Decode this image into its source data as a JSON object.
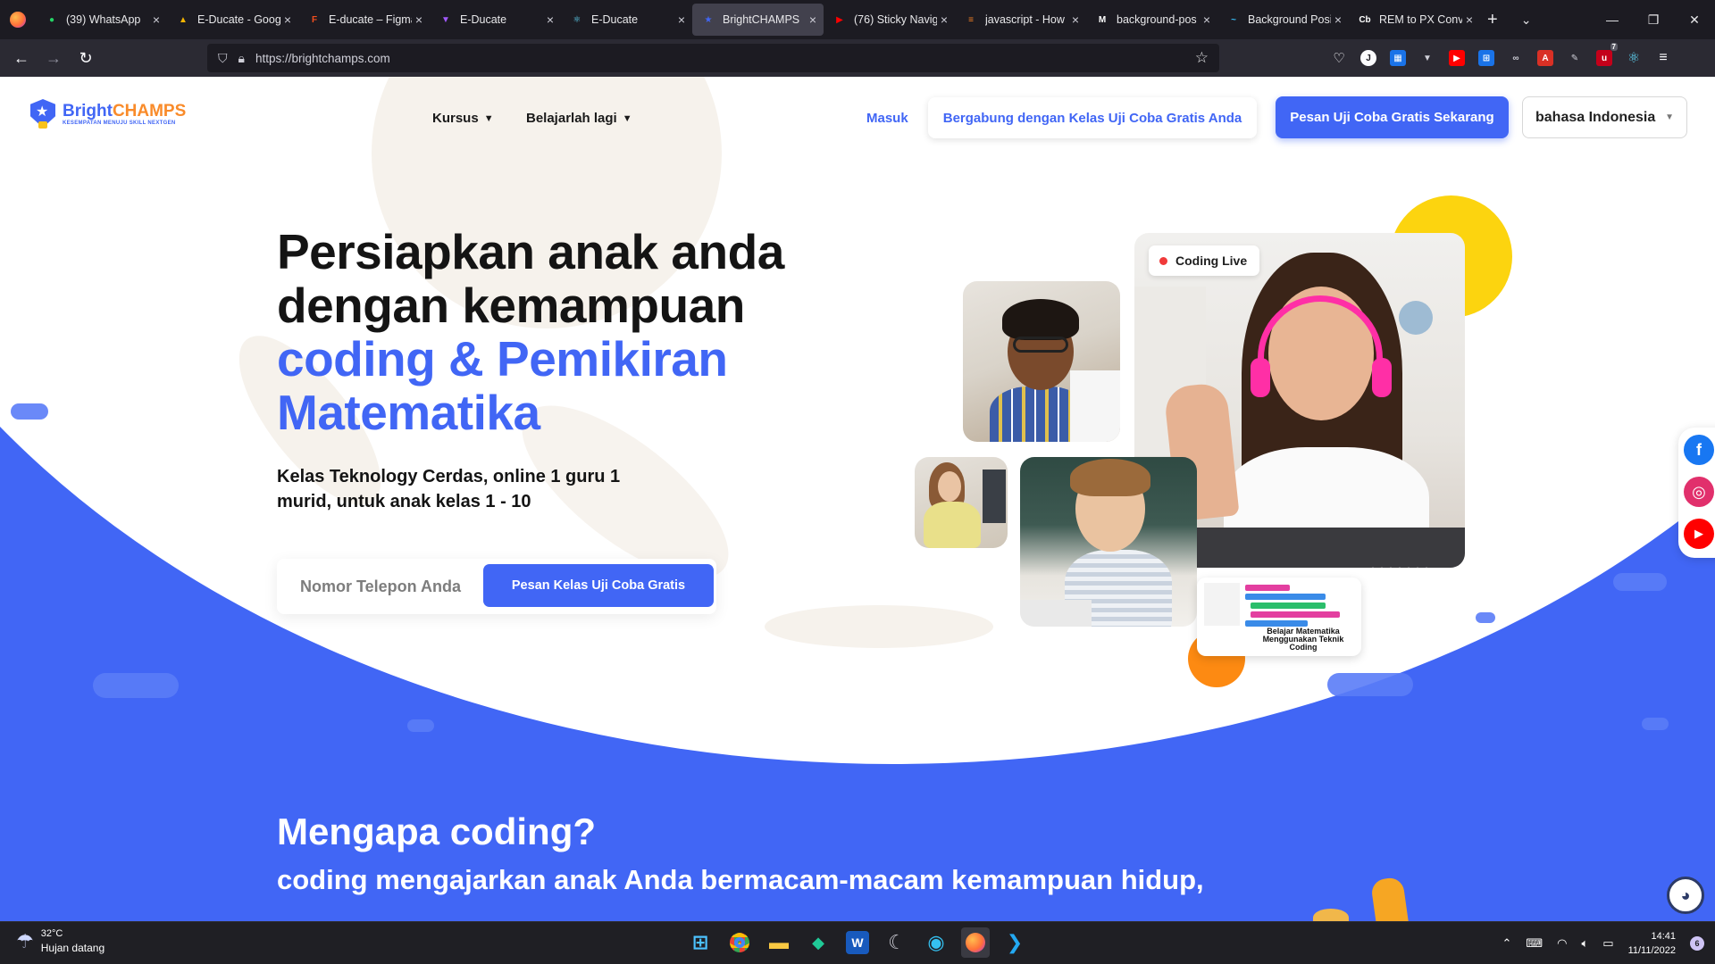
{
  "browser": {
    "tabs": [
      {
        "title": "(39) WhatsApp",
        "icon": "whatsapp-icon",
        "color": "#25d366",
        "glyph": "●"
      },
      {
        "title": "E-Ducate - Goog",
        "icon": "google-drive-icon",
        "color": "#f4b400",
        "glyph": "▲"
      },
      {
        "title": "E-ducate – Figma",
        "icon": "figma-icon",
        "color": "#f24e1e",
        "glyph": "F"
      },
      {
        "title": "E-Ducate",
        "icon": "vite-icon",
        "color": "#a259ff",
        "glyph": "▼"
      },
      {
        "title": "E-Ducate",
        "icon": "react-icon",
        "color": "#61dafb",
        "glyph": "⚛"
      },
      {
        "title": "BrightCHAMPS",
        "icon": "brightchamps-icon",
        "color": "#4166f5",
        "glyph": "★",
        "active": true
      },
      {
        "title": "(76) Sticky Navig",
        "icon": "youtube-icon",
        "color": "#ff0000",
        "glyph": "▶"
      },
      {
        "title": "javascript - How",
        "icon": "stackoverflow-icon",
        "color": "#f48024",
        "glyph": "≡"
      },
      {
        "title": "background-pos",
        "icon": "mdn-icon",
        "color": "#ffffff",
        "glyph": "M"
      },
      {
        "title": "Background Posi",
        "icon": "tailwind-icon",
        "color": "#38bdf8",
        "glyph": "~"
      },
      {
        "title": "REM to PX Conv",
        "icon": "cb-icon",
        "color": "#ffffff",
        "glyph": "Cb"
      }
    ],
    "url": "https://brightchamps.com",
    "extension_badge": "7"
  },
  "header": {
    "logo_brand_a": "Bright",
    "logo_brand_b": "CHAMPS",
    "logo_tagline": "KESEMPATAN MENUJU SKILL NEXTGEN",
    "menu_courses": "Kursus",
    "menu_learn": "Belajarlah lagi",
    "login": "Masuk",
    "join_trial": "Bergabung dengan Kelas Uji Coba Gratis Anda",
    "book_trial": "Pesan Uji Coba Gratis Sekarang",
    "language": "bahasa Indonesia"
  },
  "hero": {
    "title_line1": "Persiapkan anak anda",
    "title_line2": "dengan kemampuan",
    "title_line3": "coding & Pemikiran",
    "title_line4": "Matematika",
    "subtitle": "Kelas Teknology Cerdas, online 1 guru 1 murid, untuk anak kelas 1 - 10",
    "phone_placeholder": "Nomor Telepon Anda",
    "cta": "Pesan Kelas Uji Coba Gratis",
    "badge_live": "Coding Live",
    "math_caption": "Belajar Matematika Menggunakan Teknik Coding"
  },
  "why": {
    "title": "Mengapa coding?",
    "subtitle": "coding mengajarkan anak Anda bermacam-macam kemampuan hidup,"
  },
  "taskbar": {
    "temperature": "32°C",
    "weather": "Hujan datang",
    "time": "14:41",
    "date": "11/11/2022",
    "notification_count": "6"
  },
  "colors": {
    "brand_blue": "#4166f5",
    "brand_orange": "#f98b2a",
    "accent_yellow": "#fcd40f"
  }
}
